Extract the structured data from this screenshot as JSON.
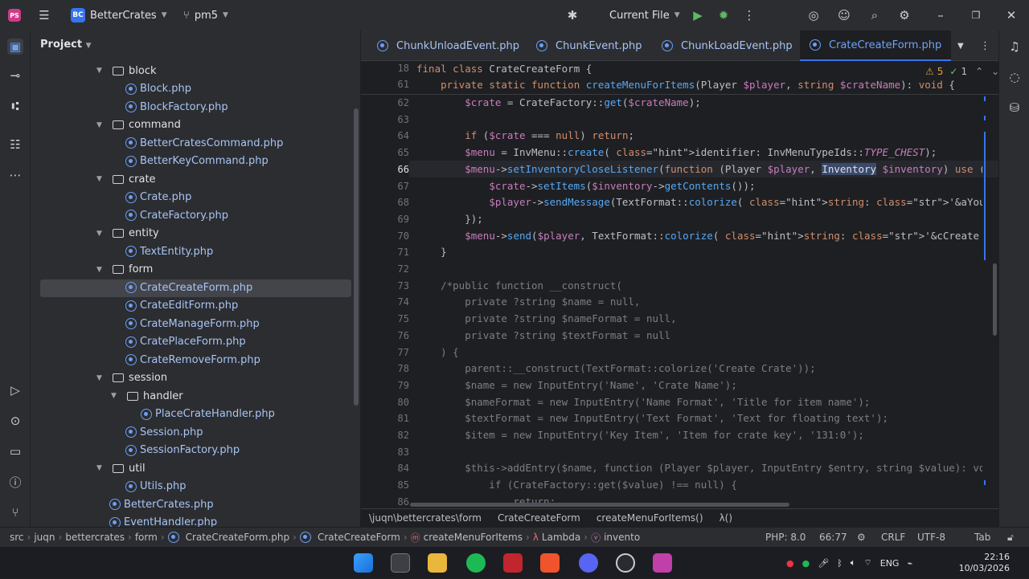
{
  "titlebar": {
    "project_badge": "BC",
    "project_name": "BetterCrates",
    "branch": "pm5",
    "run_config": "Current File"
  },
  "project_panel": {
    "title": "Project",
    "tree": [
      {
        "label": "block",
        "type": "folder",
        "depth": 1
      },
      {
        "label": "Block.php",
        "type": "file",
        "depth": 2
      },
      {
        "label": "BlockFactory.php",
        "type": "file",
        "depth": 2
      },
      {
        "label": "command",
        "type": "folder",
        "depth": 1
      },
      {
        "label": "BetterCratesCommand.php",
        "type": "file",
        "depth": 2
      },
      {
        "label": "BetterKeyCommand.php",
        "type": "file",
        "depth": 2
      },
      {
        "label": "crate",
        "type": "folder",
        "depth": 1
      },
      {
        "label": "Crate.php",
        "type": "file",
        "depth": 2
      },
      {
        "label": "CrateFactory.php",
        "type": "file",
        "depth": 2
      },
      {
        "label": "entity",
        "type": "folder",
        "depth": 1
      },
      {
        "label": "TextEntity.php",
        "type": "file",
        "depth": 2
      },
      {
        "label": "form",
        "type": "folder",
        "depth": 1
      },
      {
        "label": "CrateCreateForm.php",
        "type": "file",
        "depth": 2
      },
      {
        "label": "CrateEditForm.php",
        "type": "file",
        "depth": 2
      },
      {
        "label": "CrateManageForm.php",
        "type": "file",
        "depth": 2
      },
      {
        "label": "CratePlaceForm.php",
        "type": "file",
        "depth": 2
      },
      {
        "label": "CrateRemoveForm.php",
        "type": "file",
        "depth": 2
      },
      {
        "label": "session",
        "type": "folder",
        "depth": 1
      },
      {
        "label": "handler",
        "type": "folder",
        "depth": 2
      },
      {
        "label": "PlaceCrateHandler.php",
        "type": "file",
        "depth": 3
      },
      {
        "label": "Session.php",
        "type": "file",
        "depth": 2
      },
      {
        "label": "SessionFactory.php",
        "type": "file",
        "depth": 2
      },
      {
        "label": "util",
        "type": "folder",
        "depth": 1
      },
      {
        "label": "Utils.php",
        "type": "file",
        "depth": 2
      },
      {
        "label": "BetterCrates.php",
        "type": "file",
        "depth": 1
      },
      {
        "label": "EventHandler.php",
        "type": "file",
        "depth": 1
      }
    ]
  },
  "tabs": [
    "ChunkUnloadEvent.php",
    "ChunkEvent.php",
    "ChunkLoadEvent.php",
    "CrateCreateForm.php"
  ],
  "editor": {
    "warnings": "5",
    "typos": "1",
    "sticky": [
      {
        "num": "18",
        "text": "final class CrateCreateForm {"
      },
      {
        "num": "61",
        "text": "    private static function createMenuForItems(Player $player, string $crateName): void {"
      }
    ],
    "lines": [
      {
        "num": "62",
        "text": "        $crate = CrateFactory::get($crateName);"
      },
      {
        "num": "63",
        "text": ""
      },
      {
        "num": "64",
        "text": "        if ($crate === null) return;"
      },
      {
        "num": "65",
        "text": "        $menu = InvMenu::create( identifier: InvMenuTypeIds::TYPE_CHEST);"
      },
      {
        "num": "66",
        "text": "        $menu->setInventoryCloseListener(function (Player $player, Inventory $inventory) use ($cra"
      },
      {
        "num": "67",
        "text": "            $crate->setItems($inventory->getContents());"
      },
      {
        "num": "68",
        "text": "            $player->sendMessage(TextFormat::colorize( string: '&aYou have been create the crate succ"
      },
      {
        "num": "69",
        "text": "        });"
      },
      {
        "num": "70",
        "text": "        $menu->send($player, TextFormat::colorize( string: '&cCreate Content'));"
      },
      {
        "num": "71",
        "text": "    }"
      },
      {
        "num": "72",
        "text": ""
      },
      {
        "num": "73",
        "text": "    /*public function __construct("
      },
      {
        "num": "74",
        "text": "        private ?string $name = null,"
      },
      {
        "num": "75",
        "text": "        private ?string $nameFormat = null,"
      },
      {
        "num": "76",
        "text": "        private ?string $textFormat = null"
      },
      {
        "num": "77",
        "text": "    ) {"
      },
      {
        "num": "78",
        "text": "        parent::__construct(TextFormat::colorize('Create Crate'));"
      },
      {
        "num": "79",
        "text": "        $name = new InputEntry('Name', 'Crate Name');"
      },
      {
        "num": "80",
        "text": "        $nameFormat = new InputEntry('Name Format', 'Title for item name');"
      },
      {
        "num": "81",
        "text": "        $textFormat = new InputEntry('Text Format', 'Text for floating text');"
      },
      {
        "num": "82",
        "text": "        $item = new InputEntry('Key Item', 'Item for crate key', '131:0');"
      },
      {
        "num": "83",
        "text": ""
      },
      {
        "num": "84",
        "text": "        $this->addEntry($name, function (Player $player, InputEntry $entry, string $value): void {"
      },
      {
        "num": "85",
        "text": "            if (CrateFactory::get($value) !== null) {"
      },
      {
        "num": "86",
        "text": "                return;"
      }
    ]
  },
  "breadcrumb": [
    "\\juqn\\bettercrates\\form",
    "CrateCreateForm",
    "createMenuForItems()",
    "λ()"
  ],
  "statusbar": {
    "path": [
      "src",
      "juqn",
      "bettercrates",
      "form",
      "CrateCreateForm.php",
      "CrateCreateForm",
      "createMenuForItems",
      "Lambda",
      "invento"
    ],
    "php": "PHP: 8.0",
    "position": "66:77",
    "line_sep": "CRLF",
    "encoding": "UTF-8",
    "indent": "Tab"
  },
  "tray": {
    "lang": "ENG",
    "time": "22:16",
    "date": "10/03/2026"
  },
  "colors": {
    "accent": "#3574f0",
    "bg": "#1e1f22",
    "panel": "#2b2d30"
  }
}
